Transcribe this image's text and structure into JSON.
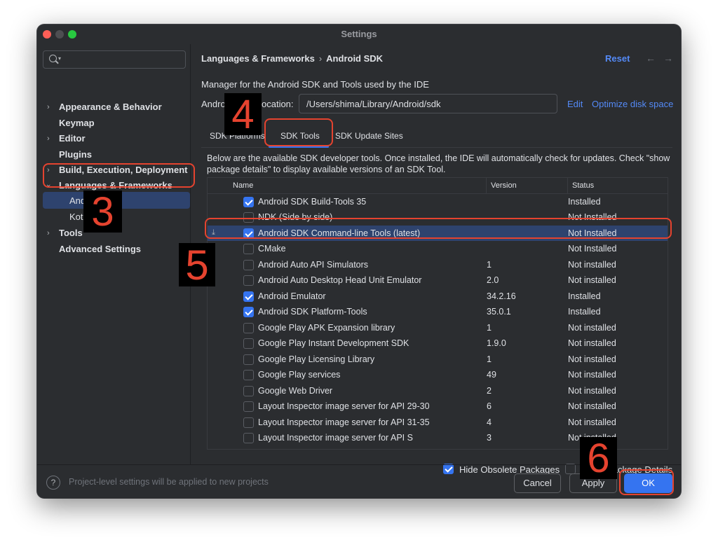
{
  "window": {
    "title": "Settings"
  },
  "sidebar": {
    "search_value": "",
    "items": [
      {
        "label": "Appearance & Behavior",
        "expandable": true
      },
      {
        "label": "Keymap",
        "expandable": false
      },
      {
        "label": "Editor",
        "expandable": true
      },
      {
        "label": "Plugins",
        "expandable": false
      },
      {
        "label": "Build, Execution, Deployment",
        "expandable": true
      },
      {
        "label": "Languages & Frameworks",
        "expandable": true,
        "expanded": true
      },
      {
        "label": "Android SDK",
        "child": true,
        "selected": true
      },
      {
        "label": "Kotlin",
        "child": true
      },
      {
        "label": "Tools",
        "expandable": true
      },
      {
        "label": "Advanced Settings",
        "expandable": false
      }
    ]
  },
  "content": {
    "breadcrumb": {
      "parent": "Languages & Frameworks",
      "separator": "›",
      "current": "Android SDK"
    },
    "reset_label": "Reset",
    "description": "Manager for the Android SDK and Tools used by the IDE",
    "location_label": "Android SDK Location:",
    "location_value": "/Users/shima/Library/Android/sdk",
    "edit_label": "Edit",
    "optimize_label": "Optimize disk space",
    "tabs": [
      {
        "label": "SDK Platforms"
      },
      {
        "label": "SDK Tools",
        "active": true
      },
      {
        "label": "SDK Update Sites"
      }
    ],
    "table_description": "Below are the available SDK developer tools. Once installed, the IDE will automatically check for updates. Check \"show package details\" to display available versions of an SDK Tool.",
    "columns": {
      "name": "Name",
      "version": "Version",
      "status": "Status"
    },
    "rows": [
      {
        "name": "Android SDK Build-Tools 35",
        "version": "",
        "status": "Installed",
        "checked": true
      },
      {
        "name": "NDK (Side by side)",
        "version": "",
        "status": "Not Installed",
        "checked": false
      },
      {
        "name": "Android SDK Command-line Tools (latest)",
        "version": "",
        "status": "Not Installed",
        "checked": true,
        "selected": true,
        "download": true
      },
      {
        "name": "CMake",
        "version": "",
        "status": "Not Installed",
        "checked": false
      },
      {
        "name": "Android Auto API Simulators",
        "version": "1",
        "status": "Not installed",
        "checked": false
      },
      {
        "name": "Android Auto Desktop Head Unit Emulator",
        "version": "2.0",
        "status": "Not installed",
        "checked": false
      },
      {
        "name": "Android Emulator",
        "version": "34.2.16",
        "status": "Installed",
        "checked": true
      },
      {
        "name": "Android SDK Platform-Tools",
        "version": "35.0.1",
        "status": "Installed",
        "checked": true
      },
      {
        "name": "Google Play APK Expansion library",
        "version": "1",
        "status": "Not installed",
        "checked": false
      },
      {
        "name": "Google Play Instant Development SDK",
        "version": "1.9.0",
        "status": "Not installed",
        "checked": false
      },
      {
        "name": "Google Play Licensing Library",
        "version": "1",
        "status": "Not installed",
        "checked": false
      },
      {
        "name": "Google Play services",
        "version": "49",
        "status": "Not installed",
        "checked": false
      },
      {
        "name": "Google Web Driver",
        "version": "2",
        "status": "Not installed",
        "checked": false
      },
      {
        "name": "Layout Inspector image server for API 29-30",
        "version": "6",
        "status": "Not installed",
        "checked": false
      },
      {
        "name": "Layout Inspector image server for API 31-35",
        "version": "4",
        "status": "Not installed",
        "checked": false
      },
      {
        "name": "Layout Inspector image server for API S",
        "version": "3",
        "status": "Not installed",
        "checked": false
      }
    ],
    "hide_obsolete_label": "Hide Obsolete Packages",
    "hide_obsolete_checked": true,
    "show_details_label": "Show Package Details",
    "show_details_checked": false
  },
  "footer": {
    "help_icon_glyph": "?",
    "hint": "Project-level settings will be applied to new projects",
    "cancel_label": "Cancel",
    "apply_label": "Apply",
    "ok_label": "OK"
  },
  "annotations": [
    "3",
    "4",
    "5",
    "6"
  ],
  "colors": {
    "window_bg": "#2b2d30",
    "selection": "#2e436e",
    "accent": "#3574f0",
    "link": "#548af7",
    "highlight_red": "#e5432f"
  }
}
